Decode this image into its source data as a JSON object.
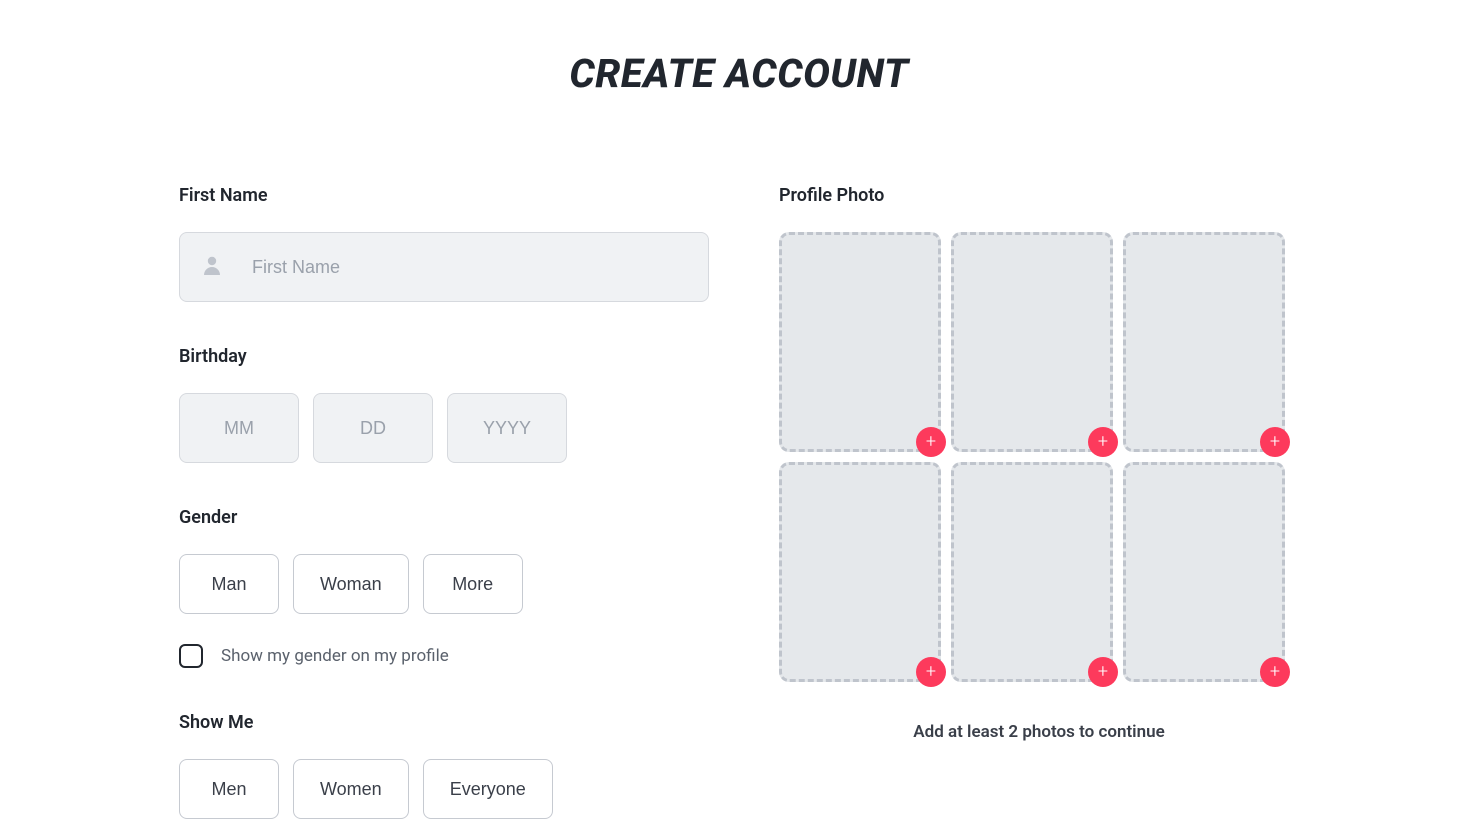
{
  "title": "CREATE ACCOUNT",
  "firstName": {
    "label": "First Name",
    "placeholder": "First Name",
    "value": ""
  },
  "birthday": {
    "label": "Birthday",
    "month": {
      "placeholder": "MM",
      "value": ""
    },
    "day": {
      "placeholder": "DD",
      "value": ""
    },
    "year": {
      "placeholder": "YYYY",
      "value": ""
    }
  },
  "gender": {
    "label": "Gender",
    "options": [
      "Man",
      "Woman",
      "More"
    ],
    "showOnProfileLabel": "Show my gender on my profile"
  },
  "showMe": {
    "label": "Show Me",
    "options": [
      "Men",
      "Women",
      "Everyone"
    ]
  },
  "profilePhoto": {
    "label": "Profile Photo",
    "hint": "Add at least 2 photos to continue"
  }
}
